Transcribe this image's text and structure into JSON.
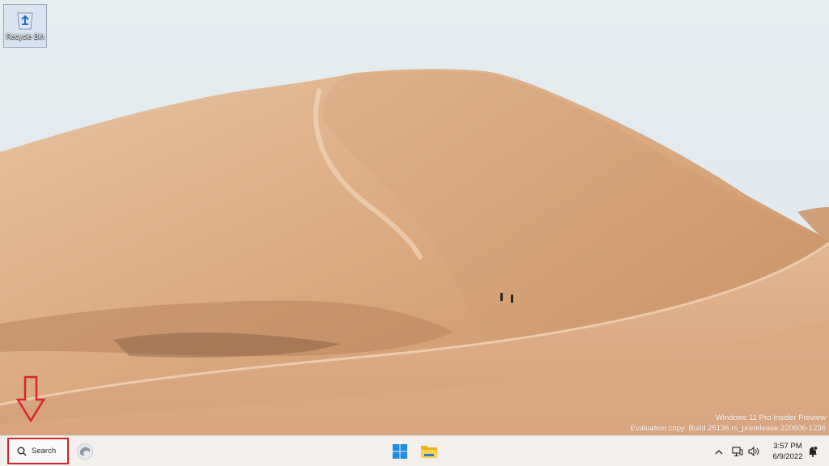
{
  "desktop": {
    "icons": [
      {
        "label": "Recycle Bin",
        "icon": "recycle-bin-icon"
      }
    ],
    "watermark": {
      "line1": "Windows 11 Pro Insider Preview",
      "line2": "Evaluation copy. Build 25136.rs_prerelease.220606-1236"
    },
    "annotation": {
      "icon": "red-arrow-down-icon",
      "color": "#d8242c"
    }
  },
  "taskbar": {
    "search": {
      "label": "Search",
      "icon": "search-icon"
    },
    "pinned": [
      {
        "icon": "edge-beta-icon"
      },
      {
        "icon": "windows-start-icon"
      },
      {
        "icon": "file-explorer-icon"
      }
    ],
    "tray": {
      "icons": [
        "chevron-up-icon",
        "network-icon",
        "volume-icon",
        "notifications-icon"
      ],
      "time": "3:57 PM",
      "date": "6/9/2022"
    }
  },
  "colors": {
    "highlight": "#d8242c",
    "taskbar_bg": "#f3efeb",
    "sky": "#e3ebf0",
    "sand": "#d6a37c"
  }
}
